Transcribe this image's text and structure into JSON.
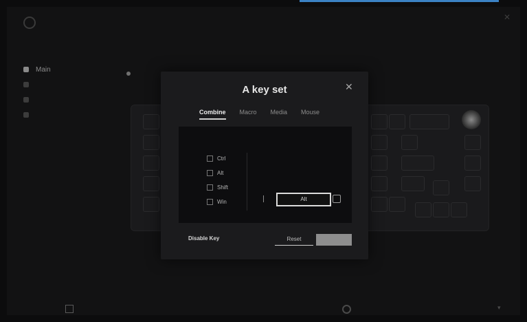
{
  "sidebar": {
    "items": [
      {
        "label": "Main"
      },
      {
        "label": ""
      },
      {
        "label": ""
      },
      {
        "label": ""
      }
    ]
  },
  "dialog": {
    "title": "A key set",
    "tabs": [
      {
        "label": "Combine"
      },
      {
        "label": "Macro"
      },
      {
        "label": "Media"
      },
      {
        "label": "Mouse"
      }
    ],
    "modifiers": [
      {
        "label": "Ctrl"
      },
      {
        "label": "Alt"
      },
      {
        "label": "Shift"
      },
      {
        "label": "Win"
      }
    ],
    "key_value": "Alt",
    "disable_label": "Disable Key",
    "reset_label": "Reset",
    "confirm_label": ""
  },
  "colors": {
    "accent": "#3b82c4",
    "dialog_bg": "#1b1b1d",
    "panel_bg": "#0d0d0f"
  }
}
